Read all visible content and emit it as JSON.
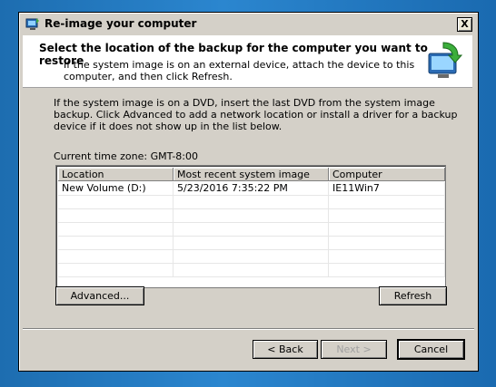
{
  "window": {
    "title": "Re-image your computer",
    "close_label": "X"
  },
  "header": {
    "title": "Select the location of the backup for the computer you want to restore",
    "description": "If the system image is on an external device, attach the device to this computer, and then click Refresh."
  },
  "body": {
    "instructions": "If the system image is on a DVD, insert the last DVD from the system image backup. Click Advanced to add a network location or install a driver for a backup device if it does not show up in the list below.",
    "timezone": "Current time zone: GMT-8:00"
  },
  "list": {
    "columns": [
      "Location",
      "Most recent system image",
      "Computer"
    ],
    "rows": [
      [
        "New Volume (D:)",
        "5/23/2016 7:35:22 PM",
        "IE11Win7"
      ],
      [
        "",
        "",
        ""
      ],
      [
        "",
        "",
        ""
      ],
      [
        "",
        "",
        ""
      ],
      [
        "",
        "",
        ""
      ],
      [
        "",
        "",
        ""
      ],
      [
        "",
        "",
        ""
      ]
    ]
  },
  "buttons": {
    "advanced": "Advanced...",
    "refresh": "Refresh",
    "back": "< Back",
    "next": "Next >",
    "cancel": "Cancel"
  },
  "colors": {
    "desktop": "#1d6db0",
    "dialog": "#d4d0c8"
  }
}
